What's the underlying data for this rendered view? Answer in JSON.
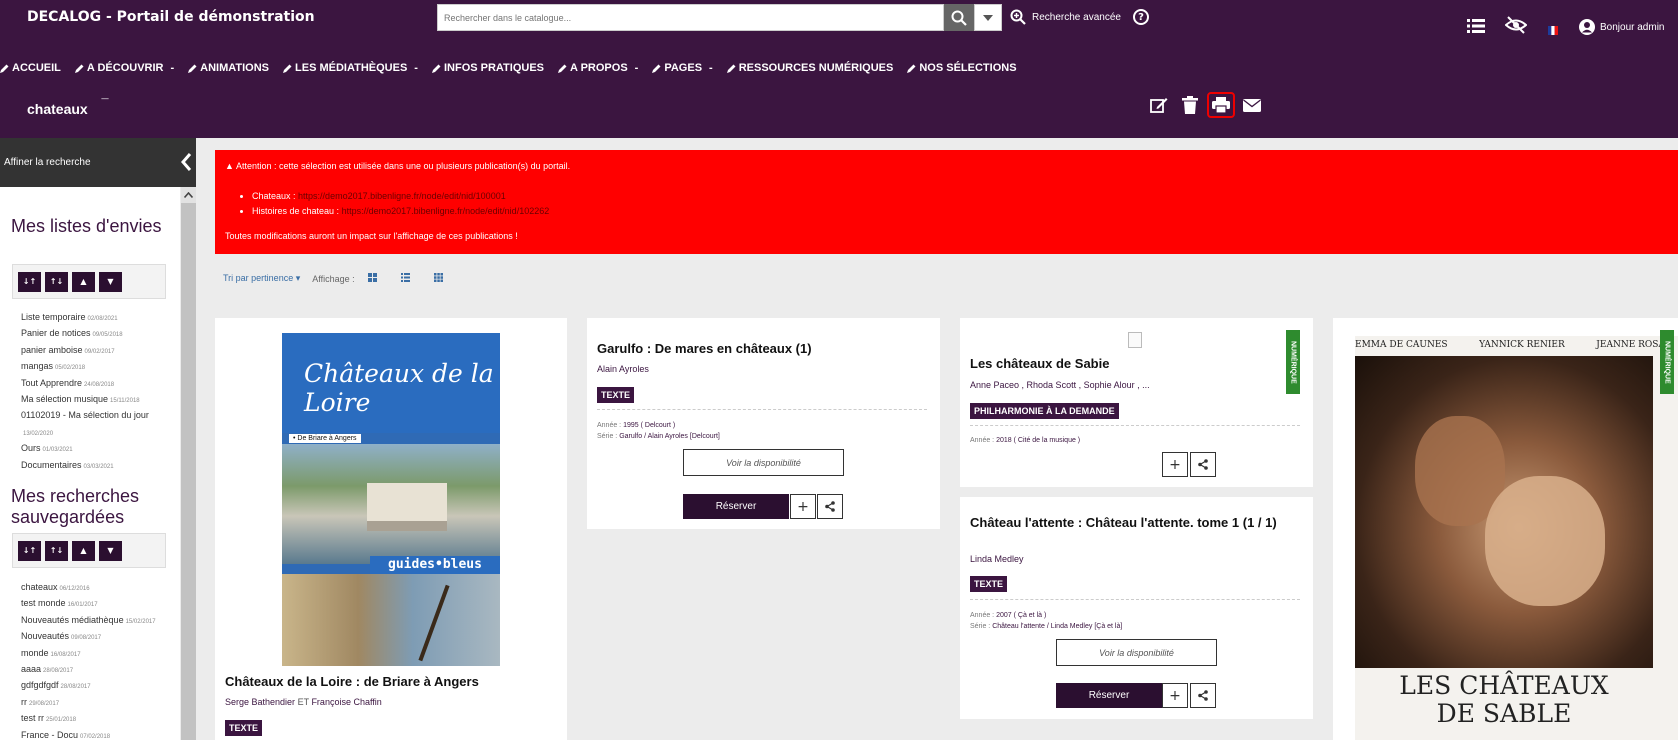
{
  "header": {
    "site_title": "DECALOG - Portail de démonstration",
    "search_placeholder": "Rechercher dans le catalogue...",
    "advanced_search": "Recherche avancée",
    "help": "?",
    "greeting": "Bonjour admin",
    "flag": "FR"
  },
  "nav": [
    {
      "label": "ACCUEIL",
      "caret": ""
    },
    {
      "label": "A DÉCOUVRIR",
      "caret": "-"
    },
    {
      "label": "ANIMATIONS",
      "caret": ""
    },
    {
      "label": "LES MÉDIATHÈQUES",
      "caret": "-"
    },
    {
      "label": "INFOS PRATIQUES",
      "caret": ""
    },
    {
      "label": "A PROPOS",
      "caret": "-"
    },
    {
      "label": "PAGES",
      "caret": "-"
    },
    {
      "label": "RESSOURCES NUMÉRIQUES",
      "caret": ""
    },
    {
      "label": "NOS SÉLECTIONS",
      "caret": ""
    }
  ],
  "selection": {
    "title": "chateaux",
    "sup": "—"
  },
  "sidebar": {
    "head": "Affiner la recherche",
    "wishlists_title": "Mes listes d'envies",
    "wishlists": [
      {
        "name": "Liste temporaire",
        "date": "02/08/2021"
      },
      {
        "name": "Panier de notices",
        "date": "09/05/2018"
      },
      {
        "name": "panier amboise",
        "date": "09/02/2017"
      },
      {
        "name": "mangas",
        "date": "05/02/2018"
      },
      {
        "name": "Tout Apprendre",
        "date": "24/08/2018"
      },
      {
        "name": "Ma sélection musique",
        "date": "15/11/2018"
      },
      {
        "name": "01102019 - Ma sélection du jour",
        "date": ""
      },
      {
        "name": "",
        "date": "13/02/2020"
      },
      {
        "name": "Ours",
        "date": "01/03/2021"
      },
      {
        "name": "Documentaires",
        "date": "03/03/2021"
      }
    ],
    "searches_title": "Mes recherches sauvegardées",
    "searches": [
      {
        "name": "chateaux",
        "date": "06/12/2016"
      },
      {
        "name": "test monde",
        "date": "16/01/2017"
      },
      {
        "name": "Nouveautés médiathèque",
        "date": "15/02/2017"
      },
      {
        "name": "Nouveautés",
        "date": "09/08/2017"
      },
      {
        "name": "monde",
        "date": "16/08/2017"
      },
      {
        "name": "aaaa",
        "date": "28/08/2017"
      },
      {
        "name": "gdfgdfgdf",
        "date": "28/08/2017"
      },
      {
        "name": "rr",
        "date": "29/08/2017"
      },
      {
        "name": "test rr",
        "date": "25/01/2018"
      },
      {
        "name": "France - Docu",
        "date": "07/02/2018"
      }
    ]
  },
  "alert": {
    "title": "Attention : cette sélection est utilisée dans une ou plusieurs publication(s) du portail.",
    "items": [
      {
        "label": "Chateaux :",
        "url": "https://demo2017.bibenligne.fr/node/edit/nid/100001"
      },
      {
        "label": "Histoires de chateau :",
        "url": "https://demo2017.bibenligne.fr/node/edit/nid/102262"
      }
    ],
    "footer": "Toutes modifications auront un impact sur l'affichage de ces publications !"
  },
  "toolbar": {
    "sort": "Tri par pertinence",
    "display": "Affichage :"
  },
  "labels": {
    "year": "Année :",
    "series": "Série :",
    "dispo": "Voir la disponibilité",
    "reserve": "Réserver",
    "numerique": "NUMÉRIQUE"
  },
  "cards": {
    "c1": {
      "title": "Châteaux de la Loire : de Briare à Angers",
      "author1": "Serge Bathendier",
      "et": "ET",
      "author2": "Françoise Chaffin",
      "badge": "TEXTE",
      "cover_title": "Châteaux de la Loire",
      "cover_sub": "• De Briare à Angers",
      "cover_brand": "guides•bleus"
    },
    "c2": {
      "title": "Garulfo : De mares en châteaux (1)",
      "author": "Alain Ayroles",
      "badge": "TEXTE",
      "year": "1995 ( Delcourt )",
      "series": "Garulfo / Alain Ayroles [Delcourt]"
    },
    "c3": {
      "title": "Les châteaux de Sabie",
      "authors": "Anne Paceo , Rhoda Scott , Sophie Alour , ...",
      "badge": "PHILHARMONIE À LA DEMANDE",
      "year": "2018 ( Cité de la musique )"
    },
    "c4": {
      "title": "Château l'attente : Château l'attente. tome 1 (1 / 1)",
      "author": "Linda Medley",
      "badge": "TEXTE",
      "year": "2007 ( Çà et là )",
      "series": "Château l'attente / Linda Medley [Çà et là]"
    },
    "c5": {
      "actors": [
        "EMMA DE CAUNES",
        "YANNICK RENIER",
        "JEANNE ROSA"
      ],
      "poster_title": "LES CHÂTEAUX DE SABLE"
    }
  }
}
